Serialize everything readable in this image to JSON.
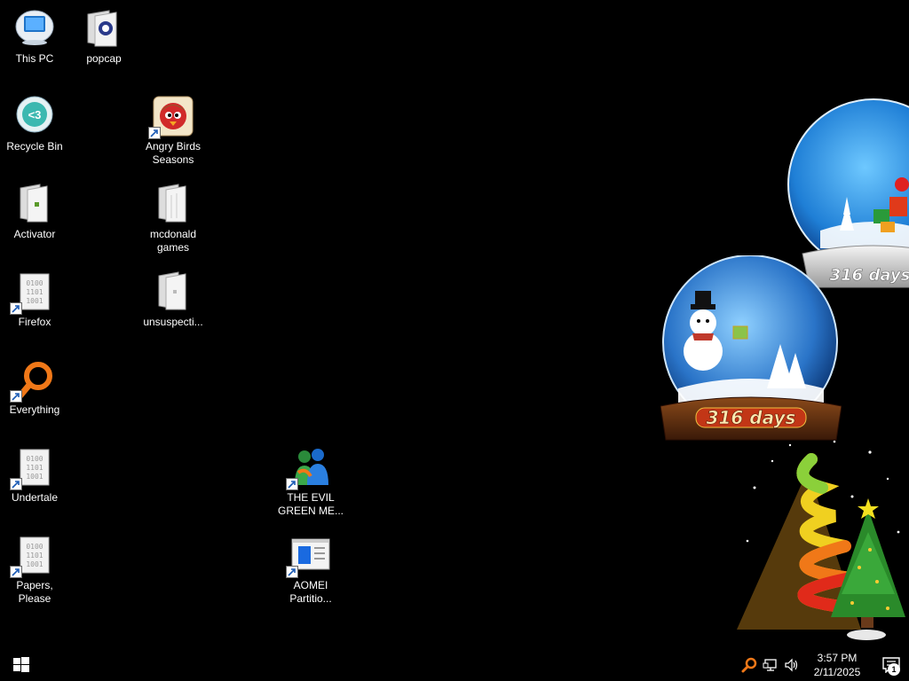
{
  "desktop_icons": [
    {
      "label": "This PC",
      "icon": "this-pc-icon",
      "shortcut": false
    },
    {
      "label": "popcap",
      "icon": "folder-icon",
      "shortcut": false
    },
    {
      "label": "Recycle Bin",
      "icon": "recycle-bin-icon",
      "shortcut": false
    },
    {
      "label": "Angry Birds Seasons",
      "icon": "angry-birds-icon",
      "shortcut": true
    },
    {
      "label": "Activator",
      "icon": "folder-icon",
      "shortcut": false
    },
    {
      "label": "mcdonald games",
      "icon": "folder-icon",
      "shortcut": false
    },
    {
      "label": "Firefox",
      "icon": "binary-file-icon",
      "shortcut": true
    },
    {
      "label": "unsuspecti...",
      "icon": "folder-icon",
      "shortcut": false
    },
    {
      "label": "Everything",
      "icon": "everything-search-icon",
      "shortcut": true
    },
    {
      "label": "Undertale",
      "icon": "binary-file-icon",
      "shortcut": true
    },
    {
      "label": "THE EVIL GREEN ME...",
      "icon": "messenger-icon",
      "shortcut": true
    },
    {
      "label": "Papers, Please",
      "icon": "binary-file-icon",
      "shortcut": true
    },
    {
      "label": "AOMEI Partitio...",
      "icon": "aomei-partition-icon",
      "shortcut": true
    }
  ],
  "widgets": {
    "globe_top_days": "316 days",
    "globe_main_days": "316 days"
  },
  "taskbar": {
    "start_icon": "windows-start-icon",
    "tray_icons": [
      "everything-search-icon",
      "network-icon",
      "volume-icon"
    ],
    "time": "3:57 PM",
    "date": "2/11/2025",
    "notification_count": "1"
  },
  "colors": {
    "background": "#000000",
    "globe_blue": "#2a7fd4",
    "ribbon_red": "#c23616"
  }
}
